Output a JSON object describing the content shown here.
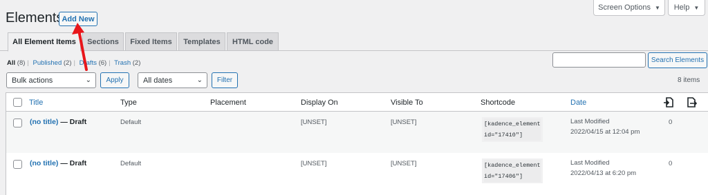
{
  "page": {
    "title": "Elements",
    "add_new": "Add New"
  },
  "top_buttons": {
    "screen_options": "Screen Options",
    "help": "Help"
  },
  "tabs": [
    {
      "label": "All Element Items",
      "active": true
    },
    {
      "label": "Sections",
      "active": false
    },
    {
      "label": "Fixed Items",
      "active": false
    },
    {
      "label": "Templates",
      "active": false
    },
    {
      "label": "HTML code",
      "active": false
    }
  ],
  "views": [
    {
      "label": "All",
      "count": "(8)"
    },
    {
      "label": "Published",
      "count": "(2)"
    },
    {
      "label": "Drafts",
      "count": "(6)"
    },
    {
      "label": "Trash",
      "count": "(2)"
    }
  ],
  "search": {
    "value": "",
    "button": "Search Elements"
  },
  "filters": {
    "bulk_actions": "Bulk actions",
    "apply": "Apply",
    "dates": "All dates",
    "filter": "Filter",
    "items_count": "8 items"
  },
  "columns": [
    "Title",
    "Type",
    "Placement",
    "Display On",
    "Visible To",
    "Shortcode",
    "Date"
  ],
  "rows": [
    {
      "title": "(no title)",
      "state": " — Draft",
      "type": "Default",
      "placement": "",
      "display_on": "[UNSET]",
      "visible_to": "[UNSET]",
      "shortcode_line1": "[kadence_element",
      "shortcode_line2": "id=\"17410\"]",
      "date_label": "Last Modified",
      "date_value": "2022/04/15 at 12:04 pm",
      "count": "0"
    },
    {
      "title": "(no title)",
      "state": " — Draft",
      "type": "Default",
      "placement": "",
      "display_on": "[UNSET]",
      "visible_to": "[UNSET]",
      "shortcode_line1": "[kadence_element",
      "shortcode_line2": "id=\"17406\"]",
      "date_label": "Last Modified",
      "date_value": "2022/04/13 at 6:20 pm",
      "count": "0"
    }
  ],
  "colors": {
    "accent": "#2271b1",
    "annotation_arrow": "#e8161b"
  }
}
